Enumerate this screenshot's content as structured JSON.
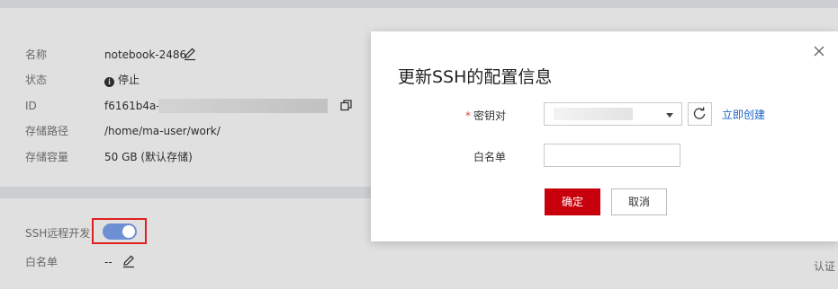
{
  "details": {
    "name_label": "名称",
    "name_value": "notebook-2486",
    "status_label": "状态",
    "status_icon": "info-icon",
    "status_value": "停止",
    "id_label": "ID",
    "id_value": "f6161b4a-6(",
    "storage_path_label": "存储路径",
    "storage_path_value": "/home/ma-user/work/",
    "storage_capacity_label": "存储容量",
    "storage_capacity_value": "50 GB (默认存储)"
  },
  "ssh": {
    "remote_dev_label": "SSH远程开发",
    "remote_dev_enabled": true,
    "whitelist_label": "白名单",
    "whitelist_value": "--",
    "auth_partial": "认证"
  },
  "dialog": {
    "title": "更新SSH的配置信息",
    "keypair_required_mark": "*",
    "keypair_label": "密钥对",
    "keypair_selected": "",
    "create_link": "立即创建",
    "whitelist_label": "白名单",
    "whitelist_value": "",
    "confirm_label": "确定",
    "cancel_label": "取消",
    "close_icon": "close-icon",
    "refresh_icon": "refresh-icon"
  },
  "colors": {
    "accent": "#c7000b",
    "link": "#1a62c9",
    "toggle_on": "#6f8fd4",
    "highlight_frame": "#e02020",
    "page_band": "#e9ebee"
  }
}
